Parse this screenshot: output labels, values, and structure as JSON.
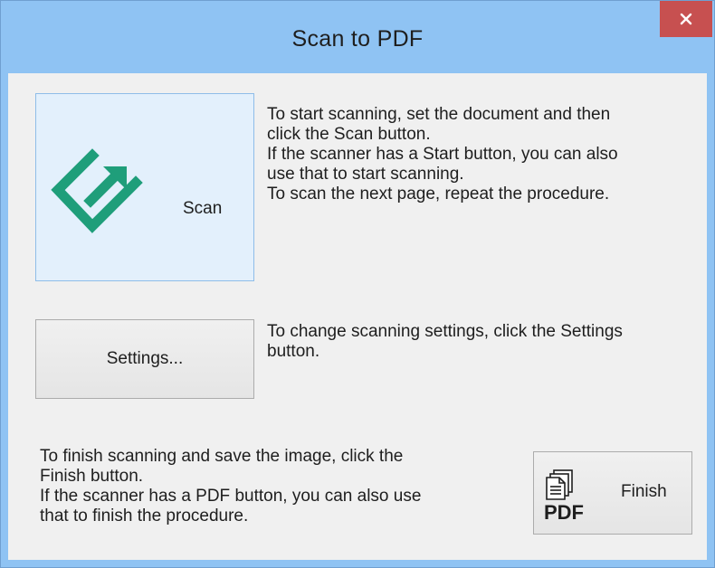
{
  "window": {
    "title": "Scan to PDF",
    "close_symbol": "×"
  },
  "buttons": {
    "scan": {
      "label": "Scan",
      "icon": "scan-start-icon"
    },
    "settings": {
      "label": "Settings..."
    },
    "finish": {
      "label": "Finish",
      "icon": "pdf-document-icon",
      "icon_text": "PDF"
    }
  },
  "descriptions": {
    "scan": [
      "To start scanning, set the document and then",
      "click the Scan button.",
      "If the scanner has a Start button, you can also",
      "use that to start scanning.",
      "To scan the next page, repeat the procedure."
    ],
    "settings": [
      "To change scanning settings, click the Settings",
      "button."
    ],
    "finish": [
      "To finish scanning and save the image, click the",
      "Finish button.",
      "If the scanner has a PDF button, you can also use",
      "that to finish the procedure."
    ]
  },
  "colors": {
    "titlebar": "#8fc3f3",
    "close_button": "#c75050",
    "scan_icon": "#1f9e7a",
    "client_background": "#f0f0f0"
  }
}
